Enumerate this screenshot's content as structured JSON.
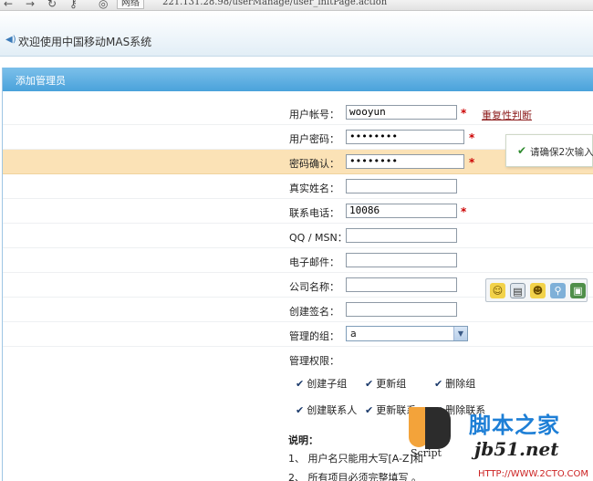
{
  "browser": {
    "address_label": "网络",
    "url": "221.131.28.98/userManage/user_initPage.action"
  },
  "header": {
    "title": "欢迎使用中国移动MAS系统"
  },
  "panel": {
    "title": "添加管理员"
  },
  "form": {
    "account_label": "用户帐号：",
    "account_value": "wooyun",
    "duplicate_check": "重复性判断",
    "password_label": "用户密码：",
    "password_mask": "••••••••",
    "confirm_label": "密码确认：",
    "confirm_mask": "••••••••",
    "realname_label": "真实姓名：",
    "phone_label": "联系电话：",
    "phone_value": "10086",
    "qq_label": "QQ / MSN：",
    "email_label": "电子邮件：",
    "company_label": "公司名称：",
    "signature_label": "创建签名：",
    "group_label": "管理的组：",
    "group_value": "a",
    "permissions_label": "管理权限：",
    "required_mark": "*"
  },
  "permissions": [
    "创建子组",
    "更新组",
    "删除组",
    "创建联系人",
    "更新联系",
    "删除联系"
  ],
  "tooltip": {
    "text": "请确保2次输入"
  },
  "notes": {
    "title": "说明：",
    "lines": [
      "1、 用户名只能用大写[A-Z]和",
      "2、 所有项目必须完整填写 。"
    ]
  },
  "watermark": {
    "script_label": "Script",
    "site_cn": "脚本之家",
    "site_domain": "jb51.net",
    "site_url": "HTTP://WWW.2CTO.COM"
  },
  "colors": {
    "panel_header": "#4aa2db",
    "highlight_row": "#fbe2b6",
    "required": "#cc0000",
    "link": "#8b1a1a"
  }
}
